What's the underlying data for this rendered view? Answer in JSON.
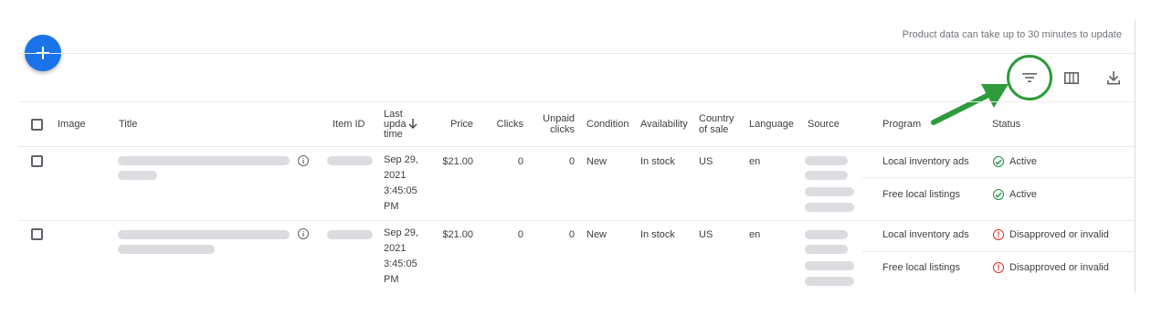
{
  "header": {
    "notice": "Product data can take up to 30 minutes to update",
    "add_icon": "add-icon"
  },
  "toolbar": {
    "filter_icon": "filter-icon",
    "columns_icon": "columns-icon",
    "download_icon": "download-icon",
    "highlight_color": "#2e9b3a"
  },
  "table": {
    "columns": {
      "image": "Image",
      "title": "Title",
      "item_id": "Item ID",
      "last_update_1": "Last",
      "last_update_2": "upda",
      "last_update_3": "time",
      "price": "Price",
      "clicks": "Clicks",
      "unpaid_1": "Unpaid",
      "unpaid_2": "clicks",
      "condition": "Condition",
      "availability": "Availability",
      "country_1": "Country",
      "country_2": "of sale",
      "language": "Language",
      "source": "Source",
      "program": "Program",
      "status": "Status"
    },
    "rows": [
      {
        "date_1": "Sep 29,",
        "date_2": "2021",
        "date_3": "3:45:05",
        "date_4": "PM",
        "price": "$21.00",
        "clicks": "0",
        "unpaid": "0",
        "condition": "New",
        "availability": "In stock",
        "country": "US",
        "language": "en",
        "programs": [
          {
            "name": "Local inventory ads",
            "status": "Active",
            "state": "ok"
          },
          {
            "name": "Free local listings",
            "status": "Active",
            "state": "ok"
          }
        ]
      },
      {
        "date_1": "Sep 29,",
        "date_2": "2021",
        "date_3": "3:45:05",
        "date_4": "PM",
        "price": "$21.00",
        "clicks": "0",
        "unpaid": "0",
        "condition": "New",
        "availability": "In stock",
        "country": "US",
        "language": "en",
        "programs": [
          {
            "name": "Local inventory ads",
            "status": "Disapproved or invalid",
            "state": "error"
          },
          {
            "name": "Free local listings",
            "status": "Disapproved or invalid",
            "state": "error"
          }
        ]
      }
    ]
  }
}
